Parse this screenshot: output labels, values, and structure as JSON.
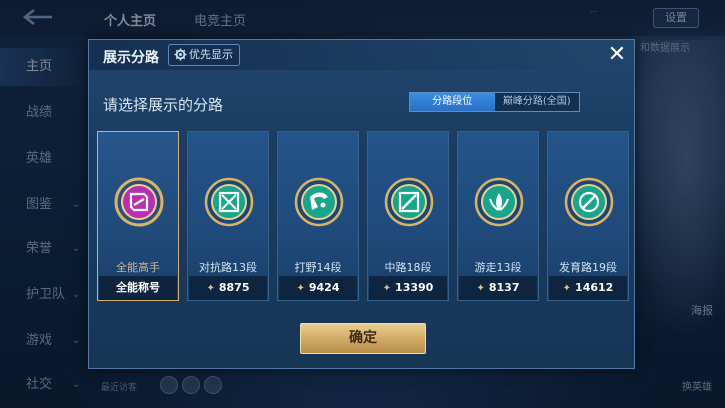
{
  "background": {
    "top_tabs": [
      "个人主页",
      "电竞主页"
    ],
    "settings_label": "设置",
    "top_note": "...",
    "side_nav": [
      {
        "label": "主页",
        "active": true
      },
      {
        "label": "战绩",
        "active": false
      },
      {
        "label": "英雄",
        "active": false
      },
      {
        "label": "图鉴",
        "active": false
      },
      {
        "label": "荣誉",
        "active": false
      },
      {
        "label": "护卫队",
        "active": false
      },
      {
        "label": "游戏",
        "active": false
      },
      {
        "label": "社交",
        "active": false
      }
    ],
    "right_labels": [
      "和数据展示",
      "海报",
      "换英雄"
    ],
    "recent_label": "最近访客"
  },
  "modal": {
    "title": "展示分路",
    "priority_label": "优先显示",
    "close": "✕",
    "subtitle": "请选择展示的分路",
    "segments": [
      {
        "label": "分路段位",
        "active": true
      },
      {
        "label": "巅峰分路(全国)",
        "active": false
      }
    ],
    "cards": [
      {
        "name": "全能高手",
        "footer": "全能称号",
        "has_star": false,
        "selected": true,
        "color": "#b92fb4"
      },
      {
        "name": "对抗路13段",
        "footer": "8875",
        "has_star": true,
        "selected": false,
        "color": "#19a58c"
      },
      {
        "name": "打野14段",
        "footer": "9424",
        "has_star": true,
        "selected": false,
        "color": "#19a58c"
      },
      {
        "name": "中路18段",
        "footer": "13390",
        "has_star": true,
        "selected": false,
        "color": "#19a58c"
      },
      {
        "name": "游走13段",
        "footer": "8137",
        "has_star": true,
        "selected": false,
        "color": "#19a58c"
      },
      {
        "name": "发育路19段",
        "footer": "14612",
        "has_star": true,
        "selected": false,
        "color": "#19a58c"
      }
    ],
    "confirm_label": "确定"
  },
  "colors": {
    "accent_blue": "#2f7fd6",
    "gold": "#d3b070",
    "modal_bg": "#1b3d63"
  }
}
